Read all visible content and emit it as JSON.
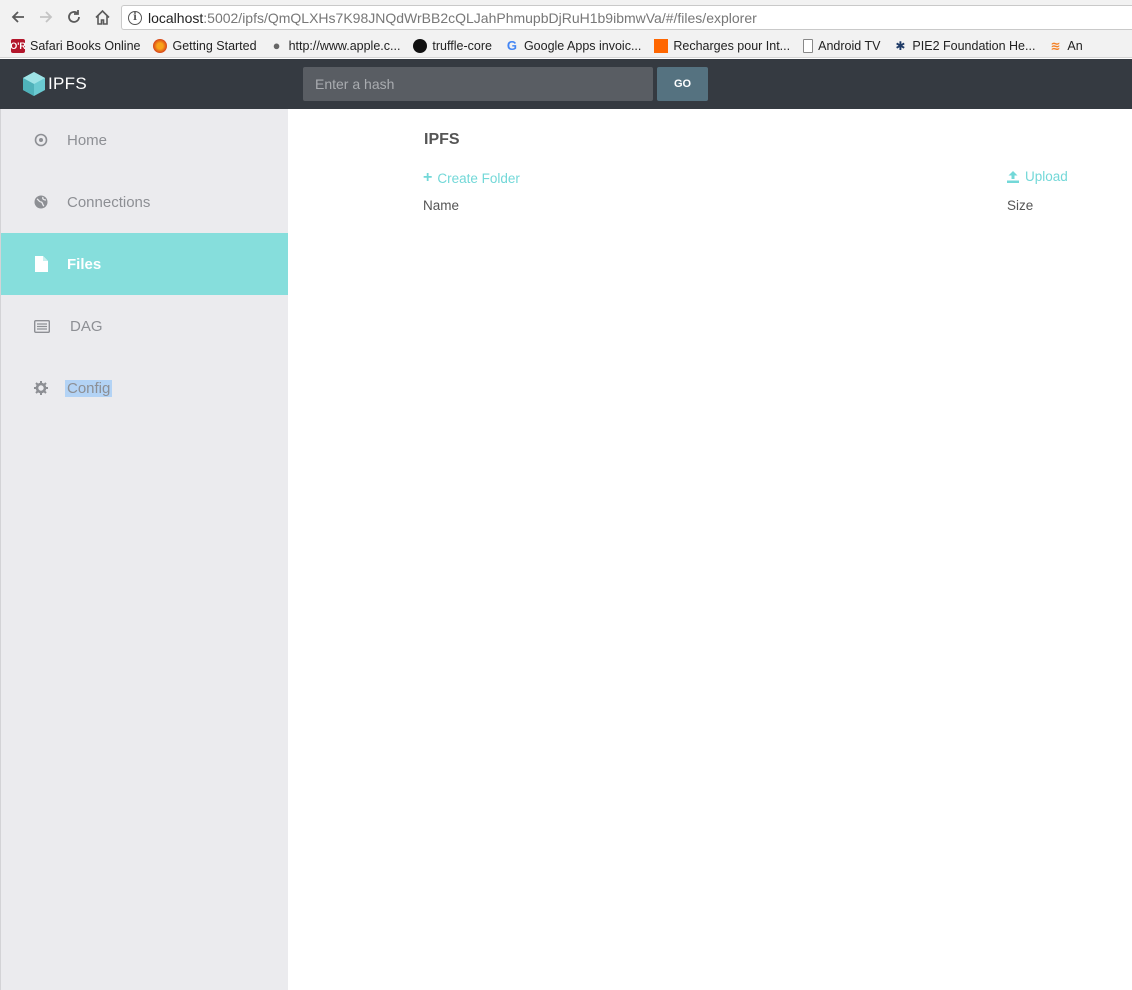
{
  "browser": {
    "url_host": "localhost",
    "url_rest": ":5002/ipfs/QmQLXHs7K98JNQdWrBB2cQLJahPhmupbDjRuH1b9ibmwVa/#/files/explorer",
    "bookmarks": [
      {
        "label": "Safari Books Online",
        "icon": "safari-books-icon"
      },
      {
        "label": "Getting Started",
        "icon": "firefox-icon"
      },
      {
        "label": "http://www.apple.c...",
        "icon": "apple-icon"
      },
      {
        "label": "truffle-core",
        "icon": "github-icon"
      },
      {
        "label": "Google Apps invoic...",
        "icon": "google-icon"
      },
      {
        "label": "Recharges pour Int...",
        "icon": "orange-icon"
      },
      {
        "label": "Android TV",
        "icon": "page-icon"
      },
      {
        "label": "PIE2 Foundation He...",
        "icon": "pie2-icon"
      },
      {
        "label": "An",
        "icon": "stackoverflow-icon"
      }
    ]
  },
  "header": {
    "brand": "IPFS",
    "hash_placeholder": "Enter a hash",
    "go_label": "GO"
  },
  "sidebar": {
    "items": [
      {
        "label": "Home",
        "icon": "target-icon",
        "active": false
      },
      {
        "label": "Connections",
        "icon": "globe-icon",
        "active": false
      },
      {
        "label": "Files",
        "icon": "file-icon",
        "active": true
      },
      {
        "label": "DAG",
        "icon": "list-icon",
        "active": false
      },
      {
        "label": "Config",
        "icon": "gear-icon",
        "active": false
      }
    ]
  },
  "main": {
    "title": "IPFS",
    "create_folder_label": "Create Folder",
    "upload_label": "Upload",
    "columns": {
      "name": "Name",
      "size": "Size"
    }
  },
  "colors": {
    "accent": "#86dedc",
    "link": "#73d8d8",
    "header_bg": "#353a41",
    "sidebar_bg": "#ebebee"
  }
}
